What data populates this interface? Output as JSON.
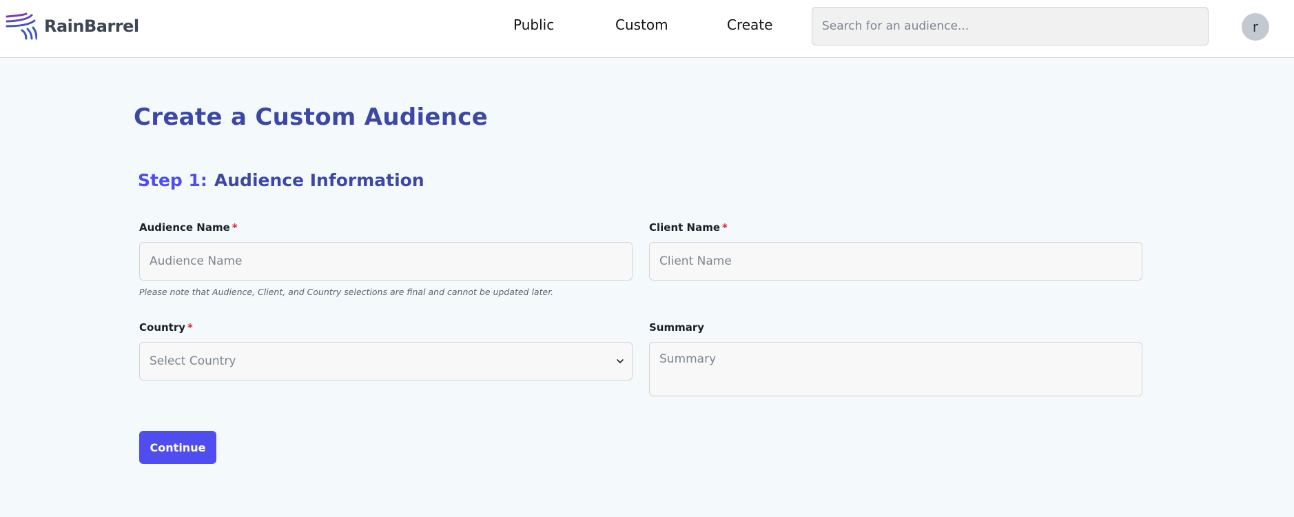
{
  "header": {
    "brand": "RainBarrel",
    "nav": [
      {
        "label": "Public"
      },
      {
        "label": "Custom"
      },
      {
        "label": "Create"
      }
    ],
    "search_placeholder": "Search for an audience...",
    "avatar_initial": "r"
  },
  "main": {
    "page_title": "Create a Custom Audience",
    "step_number": "Step 1:",
    "step_title": "Audience Information",
    "required_marker": "*",
    "fields": {
      "audience_name": {
        "label": "Audience Name",
        "placeholder": "Audience Name",
        "value": ""
      },
      "client_name": {
        "label": "Client Name",
        "placeholder": "Client Name",
        "value": ""
      },
      "country": {
        "label": "Country",
        "selected": "Select Country"
      },
      "summary": {
        "label": "Summary",
        "placeholder": "Summary",
        "value": ""
      }
    },
    "note": "Please note that Audience, Client, and Country selections are final and cannot be updated later.",
    "continue_label": "Continue"
  },
  "colors": {
    "accent": "#4f4cf0",
    "heading": "#3d48a6",
    "required": "#e0262d",
    "background": "#f4fafc"
  },
  "icons": {
    "logo": "rainbarrel-logo-icon",
    "select": "chevron-down-icon"
  }
}
